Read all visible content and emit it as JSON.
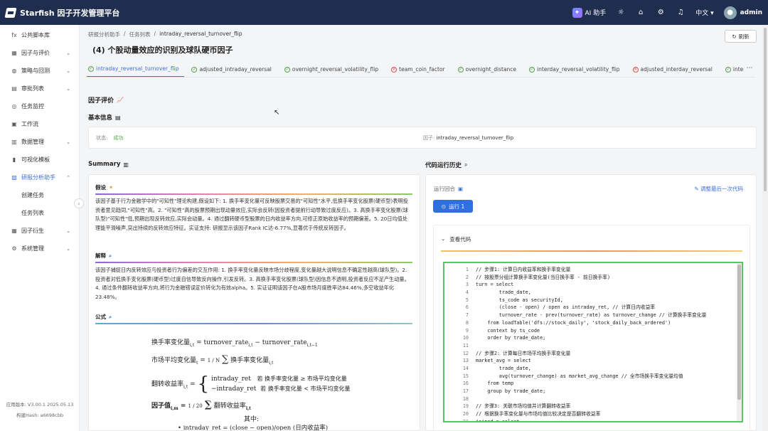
{
  "app": {
    "title": "Starfish 因子开发管理平台",
    "ai_label": "AI 助手",
    "lang": "中文",
    "user": "admin"
  },
  "sidebar": {
    "items": [
      {
        "label": "公共脚本库",
        "icon": "fx"
      },
      {
        "label": "因子与评价",
        "icon": "▦"
      },
      {
        "label": "策略与回测",
        "icon": "◍"
      },
      {
        "label": "审批列表",
        "icon": "▤"
      },
      {
        "label": "任务监控",
        "icon": "◎"
      },
      {
        "label": "工作流",
        "icon": "▣"
      },
      {
        "label": "数据管理",
        "icon": "▥"
      },
      {
        "label": "可视化模板",
        "icon": "▮"
      },
      {
        "label": "研报分析助手",
        "icon": "▧"
      }
    ],
    "sub_items": [
      {
        "label": "创建任务"
      },
      {
        "label": "任务列表"
      }
    ],
    "items_after": [
      {
        "label": "因子衍生",
        "icon": "▦"
      },
      {
        "label": "系统管理",
        "icon": "⚙"
      }
    ],
    "version": "应用版本: V3.00.1 2025.05.13",
    "build_hash": "构建Hash: a6698cbb"
  },
  "breadcrumb": [
    "研报分析助手",
    "任务列表",
    "intraday_reversal_turnover_flip"
  ],
  "page_title": "(4) 个股动量效应的识别及球队硬币因子",
  "refresh_label": "刷新",
  "tabs": [
    {
      "label": "intraday_reversal_turnover_flip",
      "status": "ok"
    },
    {
      "label": "adjusted_intraday_reversal",
      "status": "ok"
    },
    {
      "label": "overnight_reversal_volatility_flip",
      "status": "ok"
    },
    {
      "label": "team_coin_factor",
      "status": "err"
    },
    {
      "label": "overnight_distance",
      "status": "ok"
    },
    {
      "label": "interday_reversal_volatility_flip",
      "status": "ok"
    },
    {
      "label": "adjusted_interday_reversal",
      "status": "err"
    },
    {
      "label": "interday_reversal_turno",
      "status": "ok"
    }
  ],
  "factor_eval": {
    "title": "因子评价",
    "icon": "📈"
  },
  "basic_info": {
    "title": "基本信息",
    "status_label": "状态:",
    "status_value": "成功",
    "factor_label": "因子:",
    "factor_value": "intraday_reversal_turnover_flip"
  },
  "summary": {
    "title": "Summary",
    "hypothesis_title": "假设",
    "hypothesis_text": "该因子基于行为金融学中的\"可知性\"理论构建,假设如下: 1. 换手率变化量可反映股票交易的\"可知性\"水平,低换手率变化股票(硬币型)表明投资者意见趋同,\"可知性\"高。2. \"可知性\"高的股票预期出现动量效应,实际会反转(因投资者提前行动导致过度反应)。3. 高换手率变化股票(球队型)\"可知性\"低,预期出现反转效应,实际会动量。4. 通过翻转硬币型股票的日内收益率方向,可修正原始收益率的预期偏差。5. 20日均值处理能平滑噪声,突出持续的反转效应特征。实证支持: 研报显示该因子Rank IC达-6.77%,显著优于传统反转因子。",
    "explain_title": "解释",
    "explain_text": "该因子捕捉日内反转效应与投资者行为偏差的交互作用: 1. 换手率变化量反映市场分歧程度,变化量越大说明信息不确定性越高(球队型)。2. 投资者对低换手变化股票(硬币型)过度自信导致反向操作,引发反转。3. 高换手率变化股票(球队型)因信息不透明,投资者反应不足产生动量。4. 通过条件翻转收益率方向,将行为金融错误定价转化为有效alpha。5. 实证证明该因子在A股市场月度胜率达84.46%,多空收益年化23.48%。",
    "formula_title": "公式",
    "formula_lines": {
      "f1_lhs": "换手率变化量",
      "f1_rhs": "= turnover_rate",
      "f1_minus": " − turnover_rate",
      "f2_lhs": "市场平均变化量",
      "f2_frac": "1 / N",
      "f2_rhs": "换手率变化量",
      "f3_lhs": "翻转收益率",
      "f3_case1": "intraday_ret",
      "f3_cond1": "若 换手率变化量 ≥ 市场平均变化量",
      "f3_case2": "−intraday_ret",
      "f3_cond2": "若 换手率变化量 < 市场平均变化量",
      "f4_lhs": "因子值",
      "f4_frac": "1 / 20",
      "f4_rhs": "翻转收益率",
      "where": "其中:",
      "bullet1": "• intraday_ret = (close − open)/open (日内收益率)"
    }
  },
  "code_history": {
    "title": "代码运行历史",
    "run_round_label": "运行回合",
    "adjust_label": "调整最后一次代码",
    "run_button": "运行 1",
    "view_code": "查看代码",
    "lines": [
      "// 步骤1: 计算日内收益率和换手率变化量",
      "// 按股票分组计算换手率变化量(当日换手率 - 前日换手率)",
      "turn = select",
      "        trade_date,",
      "        ts_code as securityId,",
      "        (close - open) / open as intraday_ret, // 计算日内收益率",
      "        turnover_rate - prev(turnover_rate) as turnover_change // 计算换手率变化量",
      "    from loadTable('dfs://stock_daily', 'stock_daily_back_ordered')",
      "    context by ts_code",
      "    order by trade_date;",
      "",
      "// 步骤2: 计算每日市场平均换手率变化量",
      "market_avg = select",
      "        trade_date,",
      "        avg(turnover_change) as market_avg_change // 全市场换手率变化量均值",
      "    from temp",
      "    group by trade_date;",
      "",
      "// 步骤3: 关联市场均值并计算翻转收益率",
      "// 根据换手率变化量与市场均值比较决定是否翻转收益率",
      "joined = select"
    ]
  }
}
